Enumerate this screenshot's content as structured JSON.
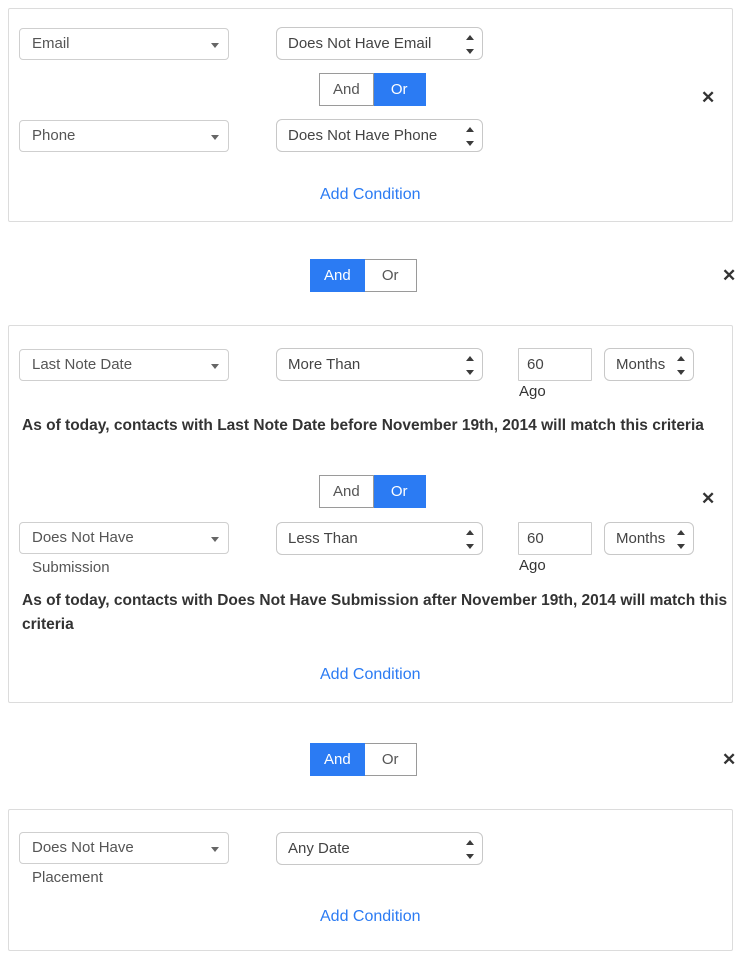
{
  "colors": {
    "accent": "#2b7bf3",
    "card_border": "#dcdcdc",
    "control_border": "#cfcfcf",
    "text": "#333333",
    "muted_text": "#555555"
  },
  "labels": {
    "add_condition": "Add Condition",
    "and": "And",
    "or": "Or",
    "ago": "Ago",
    "remove_icon": "✕"
  },
  "groups": [
    {
      "id": "group-1",
      "conditions": [
        {
          "field": "Email",
          "operator": "Does Not Have Email"
        },
        {
          "field": "Phone",
          "operator": "Does Not Have Phone"
        }
      ],
      "inner_join": {
        "and": "And",
        "or": "Or",
        "selected": "Or"
      },
      "add_condition": "Add Condition"
    },
    {
      "id": "group-2",
      "conditions": [
        {
          "field": "Last Note Date",
          "operator": "More Than",
          "amount": "60",
          "unit": "Months",
          "ago": "Ago",
          "criteria": "As of today, contacts with Last Note Date before November 19th, 2014 will match this criteria"
        },
        {
          "field": "Does Not Have Submission",
          "operator": "Less Than",
          "amount": "60",
          "unit": "Months",
          "ago": "Ago",
          "criteria": "As of today, contacts with Does Not Have Submission after November 19th, 2014 will match this criteria"
        }
      ],
      "inner_join": {
        "and": "And",
        "or": "Or",
        "selected": "Or"
      },
      "add_condition": "Add Condition"
    },
    {
      "id": "group-3",
      "conditions": [
        {
          "field": "Does Not Have Placement",
          "operator": "Any Date"
        }
      ],
      "add_condition": "Add Condition"
    }
  ],
  "group_joins": [
    {
      "and": "And",
      "or": "Or",
      "selected": "And"
    },
    {
      "and": "And",
      "or": "Or",
      "selected": "And"
    }
  ]
}
